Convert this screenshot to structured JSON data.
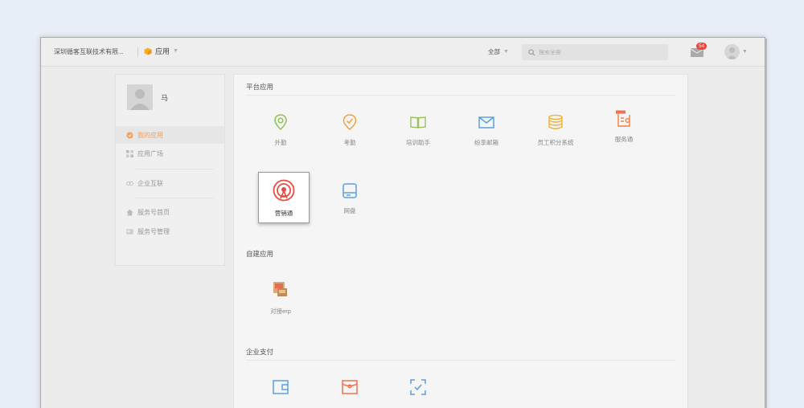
{
  "header": {
    "company": "深圳循客互联技术有限...",
    "app_switch_label": "应用",
    "filter_label": "全部",
    "search_placeholder": "搜索全部",
    "mail_badge": "54"
  },
  "sidebar": {
    "user_name": "马",
    "items": [
      {
        "label": "我的应用",
        "icon": "app-icon",
        "active": true
      },
      {
        "label": "应用广场",
        "icon": "grid-icon",
        "active": false
      },
      {
        "label": "企业互联",
        "icon": "link-icon",
        "active": false
      },
      {
        "label": "服务号首页",
        "icon": "home-icon",
        "active": false
      },
      {
        "label": "服务号管理",
        "icon": "manage-icon",
        "active": false
      }
    ]
  },
  "sections": {
    "platform": {
      "title": "平台应用",
      "apps": [
        {
          "label": "外勤",
          "icon": "location-pin-icon",
          "color": "#7bbf4a"
        },
        {
          "label": "考勤",
          "icon": "check-badge-icon",
          "color": "#f0a040"
        },
        {
          "label": "培训助手",
          "icon": "book-icon",
          "color": "#9bc25a"
        },
        {
          "label": "纷享邮箱",
          "icon": "mail-icon",
          "color": "#5aa0e0"
        },
        {
          "label": "员工积分系统",
          "icon": "database-icon",
          "color": "#f0b030"
        },
        {
          "label": "服务通",
          "icon": "service-icon",
          "color": "#f08040"
        },
        {
          "label": "营销通",
          "icon": "broadcast-icon",
          "color": "#e84c3d"
        },
        {
          "label": "网盘",
          "icon": "drive-icon",
          "color": "#5aa0e0"
        }
      ]
    },
    "custom": {
      "title": "自建应用",
      "apps": [
        {
          "label": "对接erp",
          "icon": "erp-image-icon"
        }
      ]
    },
    "payment": {
      "title": "企业支付",
      "apps": [
        {
          "icon": "wallet-icon",
          "color": "#5aa0e0"
        },
        {
          "icon": "red-packet-icon",
          "color": "#f07050"
        },
        {
          "icon": "scan-icon",
          "color": "#5aa0e0"
        }
      ]
    }
  }
}
